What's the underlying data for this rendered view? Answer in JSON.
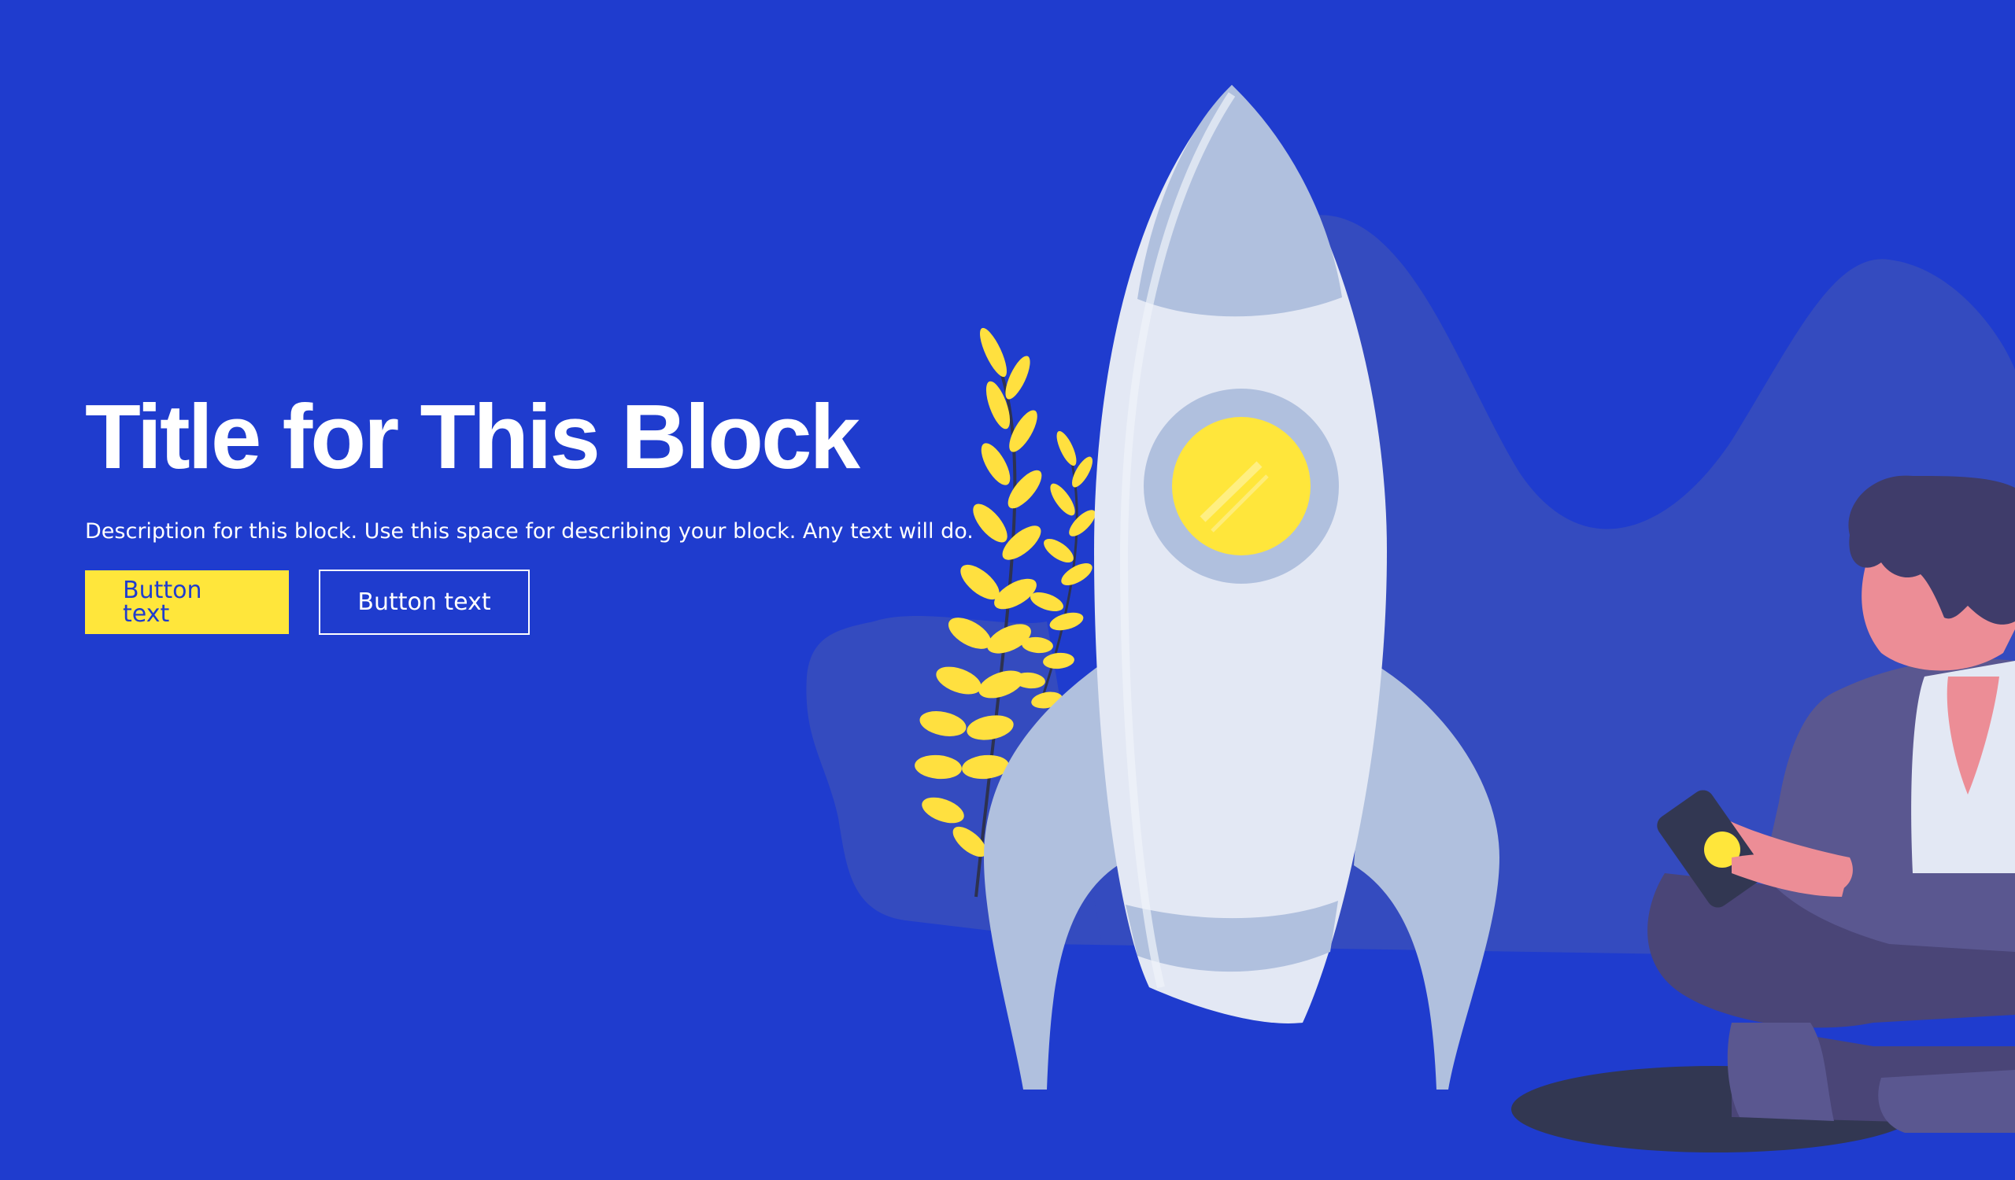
{
  "hero": {
    "title": "Title for This Block",
    "description": "Description for this block. Use this space for describing your block. Any text will do.",
    "primary_button_label": "Button text",
    "secondary_button_label": "Button text"
  },
  "colors": {
    "background": "#1f3cce",
    "accent": "#ffe63b",
    "text": "#ffffff"
  },
  "icons": {
    "illustration": "rocket-launch-illustration"
  }
}
